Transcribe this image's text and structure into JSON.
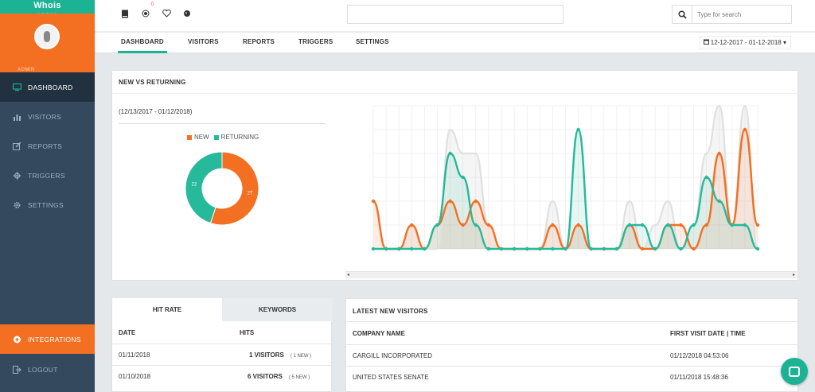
{
  "brand": {
    "name": "Whois",
    "sub": "VISITING",
    "primary_color": "#1bb394",
    "accent_color": "#f36f21",
    "sidebar_color": "#34495e"
  },
  "user": {
    "name": "ADMIN"
  },
  "sidebar": {
    "items": [
      {
        "label": "DASHBOARD",
        "icon": "monitor-icon",
        "active": true
      },
      {
        "label": "VISITORS",
        "icon": "bar-chart-icon"
      },
      {
        "label": "REPORTS",
        "icon": "edit-icon"
      },
      {
        "label": "TRIGGERS",
        "icon": "crosshair-icon"
      },
      {
        "label": "SETTINGS",
        "icon": "gear-icon"
      }
    ],
    "integrations_label": "INTEGRATIONS",
    "logout_label": "LOGOUT"
  },
  "topbar": {
    "notification_count": "0",
    "search_placeholder": "Type for search",
    "center_input_value": ""
  },
  "tabs": [
    {
      "label": "DASHBOARD",
      "active": true
    },
    {
      "label": "VISITORS"
    },
    {
      "label": "REPORTS"
    },
    {
      "label": "TRIGGERS"
    },
    {
      "label": "SETTINGS"
    }
  ],
  "date_range": "12-12-2017 - 01-12-2018",
  "new_vs_returning": {
    "title": "NEW VS RETURNING",
    "range_text": "(12/13/2017 - 01/12/2018)",
    "legend_new": "NEW",
    "legend_returning": "RETURNING",
    "new_value": "27",
    "returning_value": "22"
  },
  "chart_data": [
    {
      "type": "pie",
      "categories": [
        "NEW",
        "RETURNING"
      ],
      "values": [
        27,
        22
      ],
      "colors": [
        "#f36f21",
        "#26b99a"
      ],
      "legend": "top"
    },
    {
      "type": "area",
      "x_count": 31,
      "ylim": [
        0,
        6
      ],
      "series": [
        {
          "name": "",
          "color": "#e0e0e0",
          "values": [
            0,
            0,
            0,
            1,
            0,
            0,
            5,
            4,
            4,
            1,
            0,
            0,
            0,
            0,
            2,
            0,
            1,
            0,
            0,
            0,
            2,
            0,
            1,
            2,
            0,
            1,
            4,
            6,
            1,
            6,
            0
          ]
        },
        {
          "name": "NEW",
          "color": "#f36f21",
          "values": [
            2,
            0,
            0,
            1,
            0,
            1,
            2,
            1,
            2,
            1,
            0,
            0,
            0,
            0,
            1,
            0,
            1,
            0,
            0,
            0,
            1,
            0,
            0,
            1,
            1,
            0,
            1,
            4,
            1,
            5,
            1
          ]
        },
        {
          "name": "RETURNING",
          "color": "#26b99a",
          "values": [
            0,
            0,
            0,
            0,
            0,
            1,
            4,
            3,
            1,
            0,
            0,
            0,
            0,
            0,
            0,
            0,
            5,
            0,
            0,
            0,
            1,
            1,
            0,
            1,
            0,
            1,
            3,
            2,
            1,
            1,
            0
          ]
        }
      ]
    }
  ],
  "hit_rate": {
    "tab_hit": "HIT RATE",
    "tab_keywords": "KEYWORDS",
    "col_date": "DATE",
    "col_hits": "HITS",
    "rows": [
      {
        "date": "01/11/2018",
        "visitors": "1 VISITORS",
        "new": "( 1 NEW )"
      },
      {
        "date": "01/10/2018",
        "visitors": "6 VISITORS",
        "new": "( 5 NEW )"
      }
    ]
  },
  "latest_visitors": {
    "title": "LATEST NEW VISITORS",
    "col_company": "COMPANY NAME",
    "col_first_visit": "FIRST VISIT DATE | TIME",
    "rows": [
      {
        "company": "CARGILL INCORPORATED",
        "first_visit": "01/12/2018 04:53:06"
      },
      {
        "company": "UNITED STATES SENATE",
        "first_visit": "01/11/2018 15:48:36"
      }
    ]
  }
}
